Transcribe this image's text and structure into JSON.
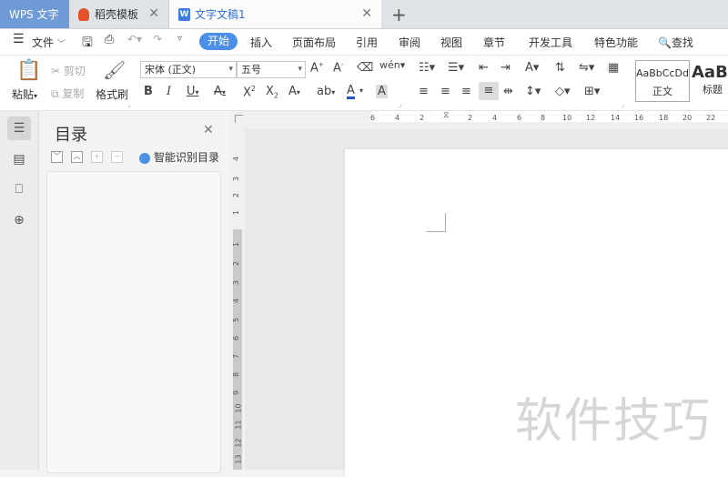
{
  "tabs": {
    "app_tab": "WPS 文字",
    "template_tab": "稻壳模板",
    "doc_tab": "文字文稿1",
    "add_tab": "+"
  },
  "menu": {
    "file": "文件",
    "items": [
      "开始",
      "插入",
      "页面布局",
      "引用",
      "审阅",
      "视图",
      "章节",
      "开发工具",
      "特色功能"
    ],
    "search": "查找"
  },
  "ribbon": {
    "paste": "粘贴",
    "cut": "剪切",
    "copy": "复制",
    "format_painter": "格式刷",
    "font_name": "宋体 (正文)",
    "font_size": "五号",
    "styles": [
      {
        "preview": "AaBbCcDd",
        "name": "正文"
      },
      {
        "preview": "AaB",
        "name": "标题"
      }
    ]
  },
  "toc_panel": {
    "title": "目录",
    "smart_button": "智能识别目录"
  },
  "ruler": {
    "h_ticks": [
      "6",
      "4",
      "2",
      "2",
      "4",
      "6",
      "8",
      "10",
      "12",
      "14",
      "16",
      "18",
      "20",
      "22"
    ],
    "v_ticks_top": [
      "4",
      "3",
      "2",
      "1"
    ],
    "v_ticks_main": [
      "1",
      "2",
      "3",
      "4",
      "5",
      "6",
      "7",
      "8",
      "9",
      "10",
      "11",
      "12",
      "13"
    ]
  },
  "watermark": "软件技巧",
  "colors": {
    "accent": "#4b8fe6",
    "app_tab_bg": "#6f9bd6",
    "doc_tab_text": "#2f6fd1",
    "font_color_underline": "#2255cc"
  }
}
